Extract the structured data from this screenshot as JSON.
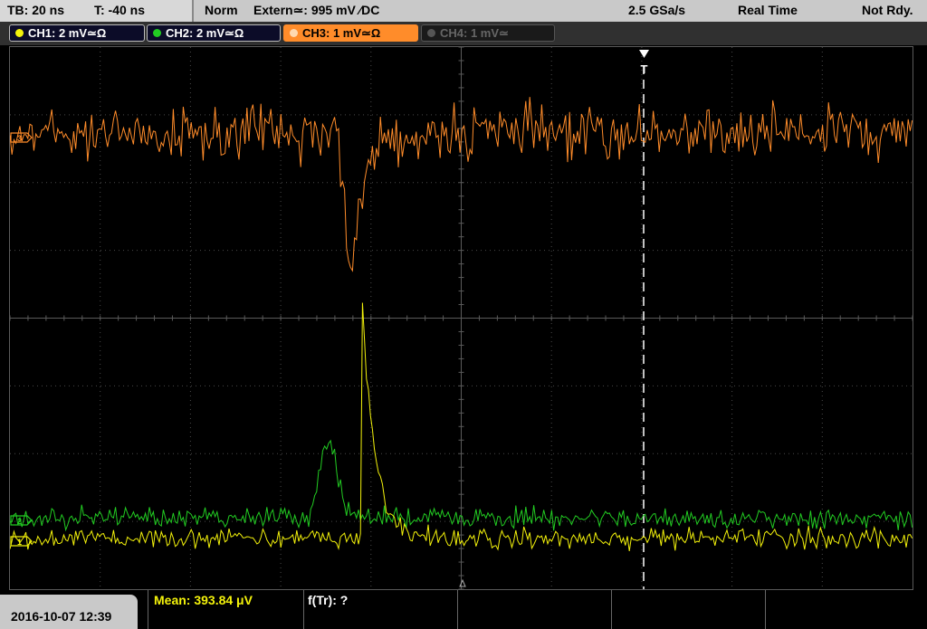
{
  "topbar": {
    "timebase": "TB: 20 ns",
    "trigger_offset": "T: -40 ns",
    "mode": "Norm",
    "trigger": "Extern≃: 995 mV ∕DC",
    "sample_rate": "2.5 GSa/s",
    "acq_mode": "Real Time",
    "status": "Not Rdy."
  },
  "channels": [
    {
      "label": "CH1: 2 mV≃Ω",
      "color": "#f3f20b",
      "active": false,
      "enabled": true
    },
    {
      "label": "CH2: 2 mV≃Ω",
      "color": "#22cc22",
      "active": false,
      "enabled": true
    },
    {
      "label": "CH3: 1 mV≃Ω",
      "color": "#ff8c2a",
      "active": true,
      "enabled": true
    },
    {
      "label": "CH4: 1 mV≃",
      "color": "#777777",
      "active": false,
      "enabled": false
    }
  ],
  "bottombar": {
    "date": "2016-10-07 12:39",
    "measurement_1": "Mean: 393.84 μV",
    "measurement_2": "f(Tr): ?"
  },
  "markers": {
    "trigger_label": "T",
    "ch3_marker": "3",
    "ch2_marker": "2",
    "ch1_marker": "1"
  },
  "colors": {
    "ch1": "#f3f20b",
    "ch2": "#22cc22",
    "ch3": "#ff8c2a",
    "ch4": "#777777",
    "grid": "#4a4a4a",
    "trigger_line": "#ffffff"
  }
}
